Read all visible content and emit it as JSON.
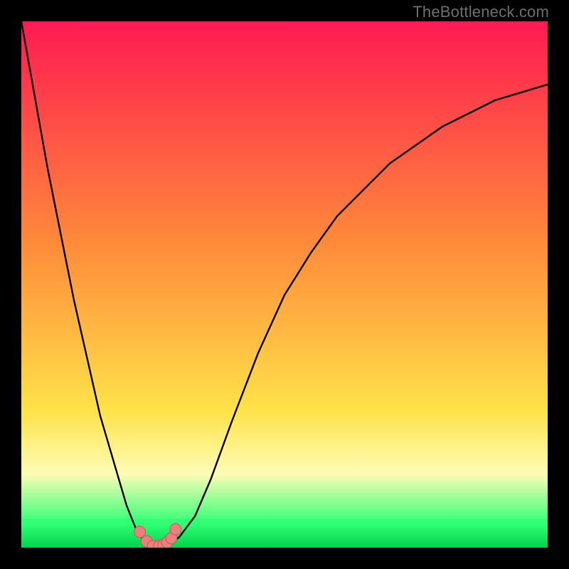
{
  "watermark": "TheBottleneck.com",
  "colors": {
    "gradient_top": "#ff1a52",
    "gradient_mid_orange": "#ff8a3a",
    "gradient_yellow": "#ffe249",
    "gradient_pale_yellow": "#fdfcb6",
    "gradient_green_band": "#31ff75",
    "gradient_green_deep": "#00d34b",
    "curve": "#000000",
    "marker_fill": "#e9807e",
    "marker_stroke": "#c25a58"
  },
  "chart_data": {
    "type": "line",
    "title": "",
    "xlabel": "",
    "ylabel": "",
    "xlim": [
      0,
      100
    ],
    "ylim": [
      0,
      100
    ],
    "series": [
      {
        "name": "bottleneck-curve",
        "x": [
          0,
          5,
          10,
          15,
          20,
          22,
          24,
          25,
          26,
          28,
          30,
          33,
          36,
          40,
          45,
          50,
          55,
          60,
          70,
          80,
          90,
          100
        ],
        "y": [
          100,
          72,
          47,
          25,
          8,
          3,
          0.5,
          0,
          0,
          0.5,
          2,
          6,
          13,
          24,
          37,
          48,
          56,
          63,
          73,
          80,
          85,
          88
        ]
      }
    ],
    "markers": {
      "name": "highlighted-points",
      "x": [
        22.5,
        23.8,
        25.0,
        26.2,
        27.0,
        27.7,
        28.5,
        29.3
      ],
      "y": [
        3.0,
        1.2,
        0.3,
        0.3,
        0.5,
        1.0,
        1.8,
        3.5
      ]
    },
    "gradient_bands": [
      {
        "pos": 0.0,
        "color_key": "gradient_top"
      },
      {
        "pos": 0.42,
        "color_key": "gradient_mid_orange"
      },
      {
        "pos": 0.74,
        "color_key": "gradient_yellow"
      },
      {
        "pos": 0.86,
        "color_key": "gradient_pale_yellow"
      },
      {
        "pos": 0.955,
        "color_key": "gradient_green_band"
      },
      {
        "pos": 1.0,
        "color_key": "gradient_green_deep"
      }
    ]
  }
}
